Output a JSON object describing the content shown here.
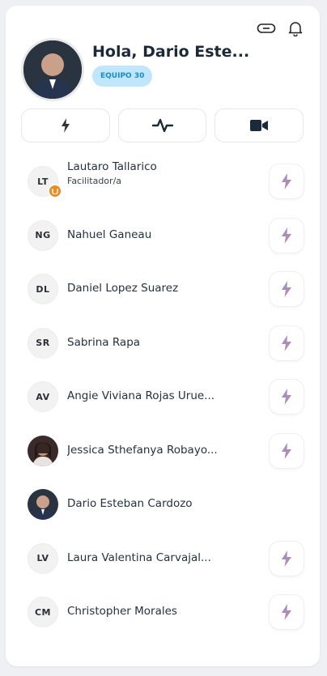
{
  "header": {
    "greeting": "Hola, Dario Este...",
    "team_badge": "EQUIPO 30"
  },
  "icons": {
    "link": "link-icon",
    "bell": "bell-icon",
    "bolt": "lightning-icon",
    "pulse": "activity-icon",
    "video": "video-camera-icon"
  },
  "colors": {
    "accent_badge_bg": "#bfe6fb",
    "accent_badge_text": "#1b8ccb",
    "facilitator_badge": "#f08a1c"
  },
  "members": [
    {
      "initials": "LT",
      "name": "Lautaro Tallarico",
      "role": "Facilitador/a"
    },
    {
      "initials": "NG",
      "name": "Nahuel Ganeau"
    },
    {
      "initials": "DL",
      "name": "Daniel Lopez Suarez"
    },
    {
      "initials": "SR",
      "name": "Sabrina Rapa"
    },
    {
      "initials": "AV",
      "name": "Angie Viviana Rojas Urue..."
    },
    {
      "initials": "",
      "name": "Jessica Sthefanya Robayo..."
    },
    {
      "initials": "",
      "name": "Dario Esteban Cardozo"
    },
    {
      "initials": "LV",
      "name": "Laura Valentina Carvajal..."
    },
    {
      "initials": "CM",
      "name": "Christopher Morales"
    }
  ]
}
